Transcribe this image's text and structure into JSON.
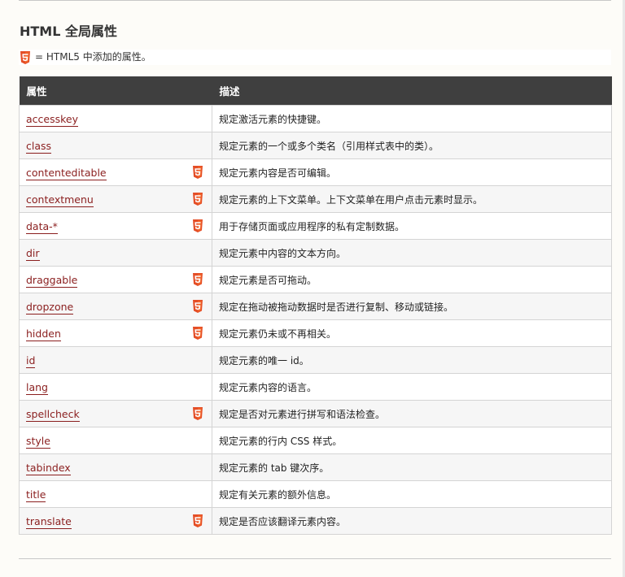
{
  "section": {
    "title": "HTML 全局属性",
    "note": "= HTML5 中添加的属性。"
  },
  "table": {
    "headers": [
      "属性",
      "描述"
    ],
    "rows": [
      {
        "name": "accesskey",
        "html5": false,
        "desc": "规定激活元素的快捷键。"
      },
      {
        "name": "class",
        "html5": false,
        "desc": "规定元素的一个或多个类名（引用样式表中的类）。"
      },
      {
        "name": "contenteditable",
        "html5": true,
        "desc": "规定元素内容是否可编辑。"
      },
      {
        "name": "contextmenu",
        "html5": true,
        "desc": "规定元素的上下文菜单。上下文菜单在用户点击元素时显示。"
      },
      {
        "name": "data-*",
        "html5": true,
        "desc": "用于存储页面或应用程序的私有定制数据。"
      },
      {
        "name": "dir",
        "html5": false,
        "desc": "规定元素中内容的文本方向。"
      },
      {
        "name": "draggable",
        "html5": true,
        "desc": "规定元素是否可拖动。"
      },
      {
        "name": "dropzone",
        "html5": true,
        "desc": "规定在拖动被拖动数据时是否进行复制、移动或链接。"
      },
      {
        "name": "hidden",
        "html5": true,
        "desc": "规定元素仍未或不再相关。"
      },
      {
        "name": "id",
        "html5": false,
        "desc": "规定元素的唯一 id。"
      },
      {
        "name": "lang",
        "html5": false,
        "desc": "规定元素内容的语言。"
      },
      {
        "name": "spellcheck",
        "html5": true,
        "desc": "规定是否对元素进行拼写和语法检查。"
      },
      {
        "name": "style",
        "html5": false,
        "desc": "规定元素的行内 CSS 样式。"
      },
      {
        "name": "tabindex",
        "html5": false,
        "desc": "规定元素的 tab 键次序。"
      },
      {
        "name": "title",
        "html5": false,
        "desc": "规定有关元素的额外信息。"
      },
      {
        "name": "translate",
        "html5": true,
        "desc": "规定是否应该翻译元素内容。"
      }
    ]
  },
  "icons": {
    "html5_badge": "html5-icon"
  },
  "colors": {
    "header_bg": "#3f3f3f",
    "link": "#8a1e1e",
    "html5_orange": "#e44d26"
  }
}
